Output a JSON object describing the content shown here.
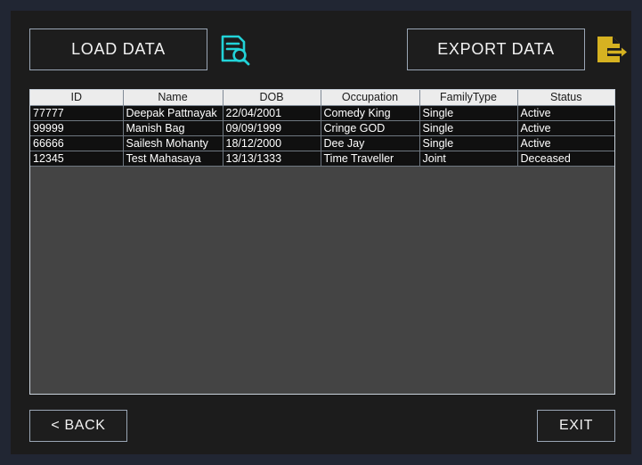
{
  "toolbar": {
    "load_data_label": "LOAD DATA",
    "export_data_label": "EXPORT DATA",
    "load_data_icon": "document-search-icon",
    "export_data_icon": "document-export-icon"
  },
  "footer": {
    "back_label": "< BACK",
    "exit_label": "EXIT"
  },
  "table": {
    "columns": [
      "ID",
      "Name",
      "DOB",
      "Occupation",
      "FamilyType",
      "Status"
    ],
    "rows": [
      {
        "id": "77777",
        "name": "Deepak Pattnayak",
        "dob": "22/04/2001",
        "occupation": "Comedy King",
        "familytype": "Single",
        "status": "Active"
      },
      {
        "id": "99999",
        "name": "Manish Bag",
        "dob": "09/09/1999",
        "occupation": "Cringe GOD",
        "familytype": "Single",
        "status": "Active"
      },
      {
        "id": "66666",
        "name": "Sailesh Mohanty",
        "dob": "18/12/2000",
        "occupation": "Dee Jay",
        "familytype": "Single",
        "status": "Active"
      },
      {
        "id": "12345",
        "name": "Test Mahasaya",
        "dob": "13/13/1333",
        "occupation": "Time Traveller",
        "familytype": "Joint",
        "status": "Deceased"
      }
    ]
  },
  "colors": {
    "window_frame": "#212633",
    "panel": "#1c1c1c",
    "button_border": "#9aa6b5",
    "accent_cyan": "#22d3d8",
    "accent_gold": "#d6b221",
    "header_bg": "#ececec",
    "row_bg": "#101010",
    "table_empty_bg": "#444444"
  }
}
